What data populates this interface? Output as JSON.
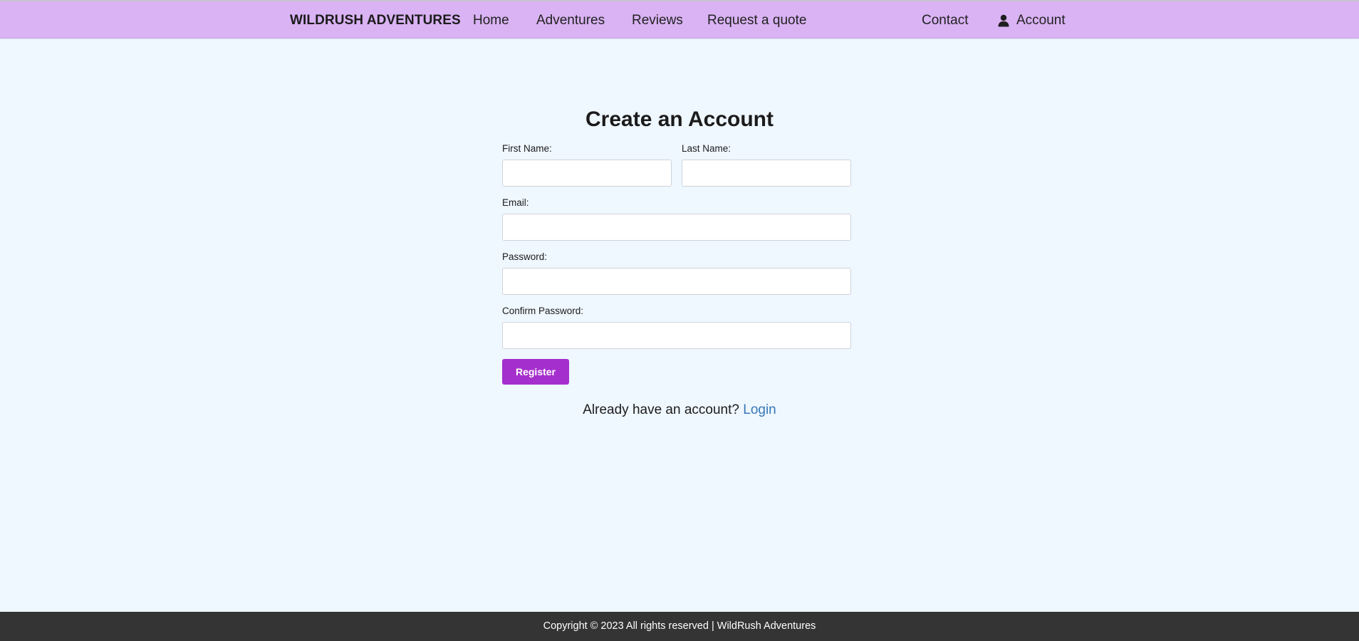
{
  "header": {
    "brand": "WILDRUSH ADVENTURES",
    "nav": {
      "home": "Home",
      "adventures": "Adventures",
      "reviews": "Reviews",
      "quote": "Request a quote",
      "contact": "Contact",
      "account": "Account"
    },
    "account_icon": "user-icon"
  },
  "form": {
    "title": "Create an Account",
    "first_name_label": "First Name:",
    "last_name_label": "Last Name:",
    "email_label": "Email:",
    "password_label": "Password:",
    "confirm_password_label": "Confirm Password:",
    "first_name_value": "",
    "last_name_value": "",
    "email_value": "",
    "password_value": "",
    "confirm_password_value": "",
    "register_label": "Register",
    "login_prompt": "Already have an account?",
    "login_link": "Login"
  },
  "footer": {
    "text": "Copyright © 2023 All rights reserved | WildRush Adventures"
  },
  "colors": {
    "header_bg": "#d9b3f3",
    "page_bg": "#eff7ff",
    "button_bg": "#a52fcc",
    "link": "#3477b8",
    "footer_bg": "#343434"
  }
}
